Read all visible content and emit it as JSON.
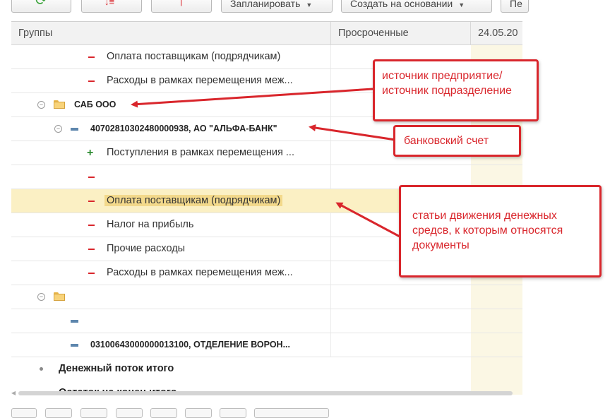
{
  "toolbar": {
    "plan_label": "Запланировать",
    "create_based_label": "Создать на основании",
    "more_label": "Пе"
  },
  "grid": {
    "col_groups": "Группы",
    "col_overdue": "Просроченные",
    "col_date": "24.05.20",
    "rows": [
      {
        "kind": "expense",
        "text": "Оплата поставщикам (подрядчикам)"
      },
      {
        "kind": "expense",
        "text": "Расходы в рамках перемещения меж..."
      },
      {
        "kind": "org",
        "text": "САБ ООО"
      },
      {
        "kind": "account",
        "text": "40702810302480000938, АО \"АЛЬФА-БАНК\""
      },
      {
        "kind": "income",
        "text": "Поступления в рамках перемещения ..."
      },
      {
        "kind": "expense",
        "text": ""
      },
      {
        "kind": "expense-selected",
        "text": "Оплата поставщикам (подрядчикам)"
      },
      {
        "kind": "expense",
        "text": "Налог на прибыль"
      },
      {
        "kind": "expense",
        "text": "Прочие расходы"
      },
      {
        "kind": "expense",
        "text": "Расходы в рамках перемещения меж..."
      },
      {
        "kind": "org",
        "text": ""
      },
      {
        "kind": "account",
        "text": ""
      },
      {
        "kind": "account",
        "text": "03100643000000013100, ОТДЕЛЕНИЕ ВОРОН..."
      },
      {
        "kind": "total",
        "text": "Денежный поток итого"
      },
      {
        "kind": "total",
        "text": "Остаток на конец итого"
      }
    ]
  },
  "notes": {
    "source": "источник предприятие/источник подразделение",
    "bank": "банковский счет",
    "articles": "статьи движения денежных средсв,  к которым относятся документы"
  },
  "colors": {
    "annotation_red": "#d9262c",
    "selected_row": "#fbf0c4",
    "date_column": "#fbf7e4",
    "income_plus": "#2a8a2f"
  },
  "icons": [
    "refresh-icon",
    "sort-icon",
    "collapse-icon",
    "folder-icon",
    "bank-account-icon",
    "expense-minus-icon",
    "income-plus-icon",
    "bullet-icon"
  ]
}
